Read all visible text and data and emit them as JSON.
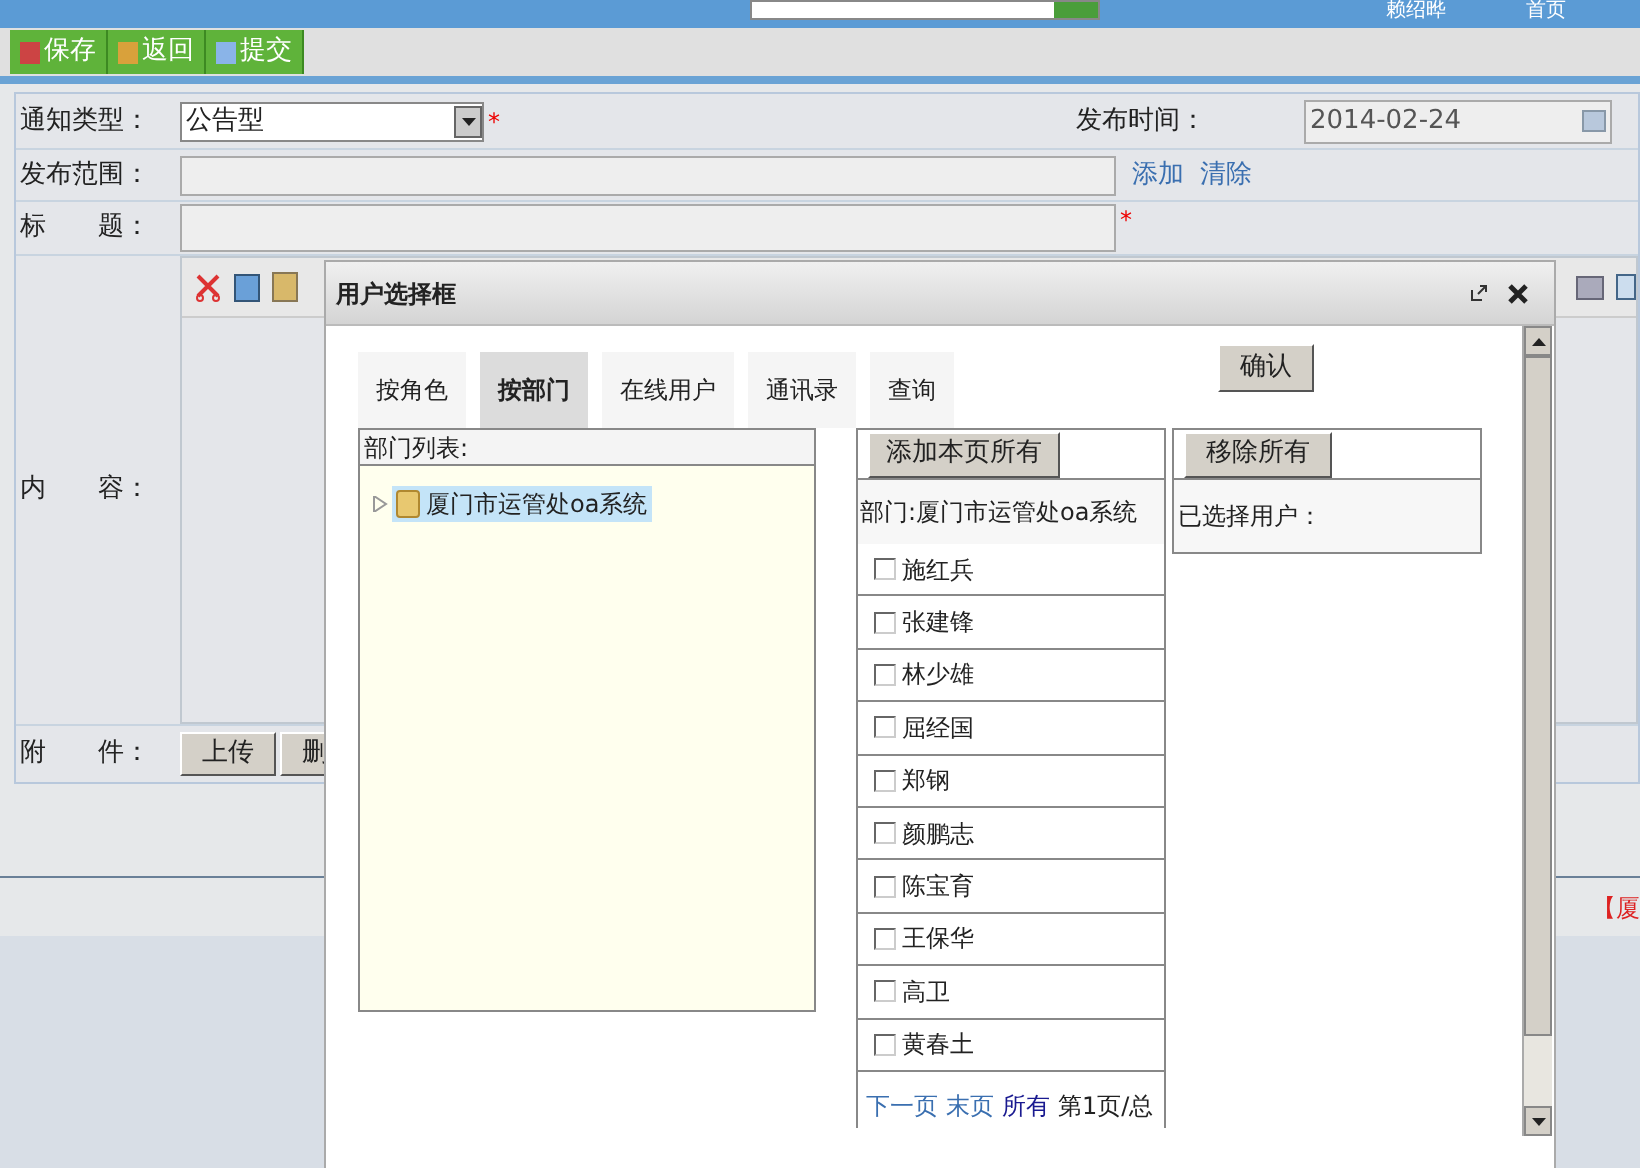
{
  "header": {
    "user": "赖绍晔",
    "home": "首页"
  },
  "toolbar": [
    "保存",
    "返回",
    "提交"
  ],
  "form": {
    "type_label": "通知类型：",
    "type_value": "公告型",
    "time_label": "发布时间：",
    "time_value": "2014-02-24",
    "scope_label": "发布范围：",
    "scope_links": [
      "添加",
      "清除"
    ],
    "title_label": "标　　题：",
    "content_label": "内　　容：",
    "attach_label": "附　　件：",
    "attach_buttons": [
      "上传",
      "删"
    ],
    "required": "*"
  },
  "footer_text": "【厦",
  "dialog": {
    "title": "用户选择框",
    "tabs": [
      {
        "label": "按角色",
        "selected": false
      },
      {
        "label": "按部门",
        "selected": true
      },
      {
        "label": "在线用户",
        "selected": false
      },
      {
        "label": "通讯录",
        "selected": false
      },
      {
        "label": "查询",
        "selected": false
      }
    ],
    "confirm": "确认",
    "dept_header": "部门列表:",
    "tree": [
      {
        "label": "厦门市运管处oa系统",
        "selected": true,
        "expanded": false
      }
    ],
    "add_all": "添加本页所有",
    "dept_caption": "部门:厦门市运管处oa系统",
    "users": [
      {
        "name": "施红兵",
        "checked": false
      },
      {
        "name": "张建锋",
        "checked": false
      },
      {
        "name": "林少雄",
        "checked": false
      },
      {
        "name": "屈经国",
        "checked": false
      },
      {
        "name": "郑钢",
        "checked": false
      },
      {
        "name": "颜鹏志",
        "checked": false
      },
      {
        "name": "陈宝育",
        "checked": false
      },
      {
        "name": "王保华",
        "checked": false
      },
      {
        "name": "高卫",
        "checked": false
      },
      {
        "name": "黄春土",
        "checked": false
      }
    ],
    "pager": {
      "links": [
        "下一页",
        "末页",
        "所有"
      ],
      "info": "第1页/总"
    },
    "remove_all": "移除所有",
    "selected_caption": "已选择用户："
  }
}
